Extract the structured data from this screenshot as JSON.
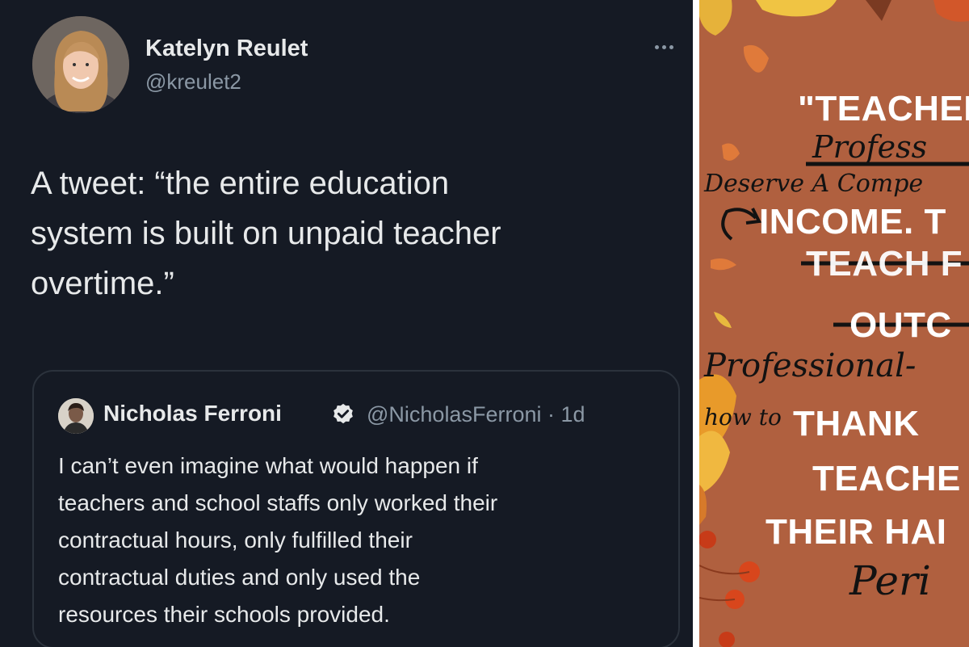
{
  "tweet": {
    "author_name": "Katelyn Reulet",
    "author_handle": "@kreulet2",
    "body_lines": [
      "A tweet: “the entire education",
      "system is built on unpaid teacher",
      "overtime.”"
    ]
  },
  "quoted_tweet": {
    "author_name": "Nicholas Ferroni",
    "handle_and_time": "@NicholasFerroni · 1d",
    "body_lines": [
      "I can’t even imagine what would happen if",
      "teachers and school staffs only worked their",
      "contractual hours, only fulfilled their",
      "contractual duties and only used the",
      "resources their schools provided."
    ]
  },
  "sign": {
    "printed": {
      "line1": "\"TEACHEI",
      "line2": "INCOME. T",
      "line3": "TEACH F",
      "line4": "OUTC",
      "line5": "THANK",
      "line6": "TEACHE",
      "line7": "THEIR HAI"
    },
    "handwritten": {
      "h1": "Profess",
      "h2": "Deserve A Compe",
      "h3": "Professional-",
      "h4": "how to",
      "h5": "Peri"
    }
  },
  "colors": {
    "tweet_background": "#151a24",
    "sign_background": "#b0603f",
    "verified_badge": "#e7e9ea"
  },
  "icons": {
    "more": "more-horizontal-icon",
    "verified": "verified-badge-icon",
    "arrow": "hand-drawn-arrow-icon"
  }
}
